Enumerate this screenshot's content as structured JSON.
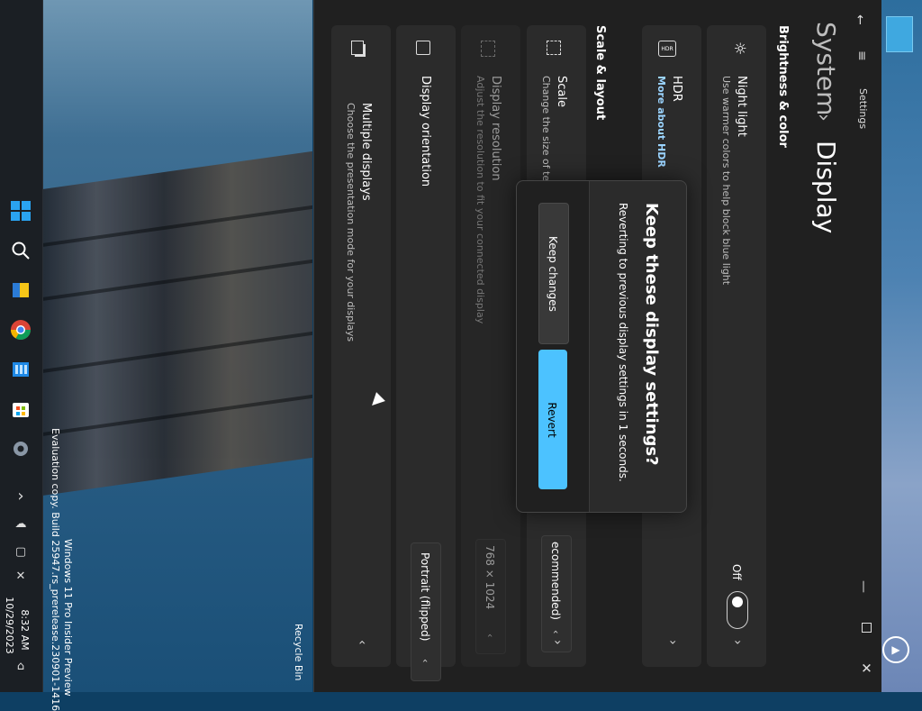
{
  "window": {
    "app_name": "Settings",
    "breadcrumb_parent": "System",
    "breadcrumb_sep": "›",
    "page_title": "Display"
  },
  "sections": {
    "brightness": "Brightness & color",
    "scale_layout": "Scale & layout"
  },
  "night_light": {
    "title": "Night light",
    "subtitle": "Use warmer colors to help block blue light",
    "state": "Off"
  },
  "hdr": {
    "title": "HDR",
    "link": "More about HDR"
  },
  "scale": {
    "title": "Scale",
    "subtitle": "Change the size of te",
    "value": "ecommended)"
  },
  "resolution": {
    "title": "Display resolution",
    "subtitle": "Adjust the resolution to fit your connected display",
    "value": "768 × 1024"
  },
  "orientation": {
    "title": "Display orientation",
    "value": "Portrait (flipped)"
  },
  "multiple": {
    "title": "Multiple displays",
    "subtitle": "Choose the presentation mode for your displays"
  },
  "dialog": {
    "title": "Keep these display settings?",
    "message": "Reverting to previous display settings in  1 seconds.",
    "keep_label": "Keep changes",
    "revert_label": "Revert"
  },
  "taskbar": {
    "time": "8:32 AM",
    "date": "10/29/2023",
    "expand": "›"
  },
  "desktop": {
    "recycle_bin": "Recycle Bin",
    "watermark_line1": "Windows 11 Pro Insider Preview",
    "watermark_line2": "Evaluation copy. Build 25947.rs_prerelease.230901-1416"
  },
  "colors": {
    "accent": "#4cc2ff",
    "window_bg": "#202020",
    "card_bg": "#2b2b2b"
  }
}
